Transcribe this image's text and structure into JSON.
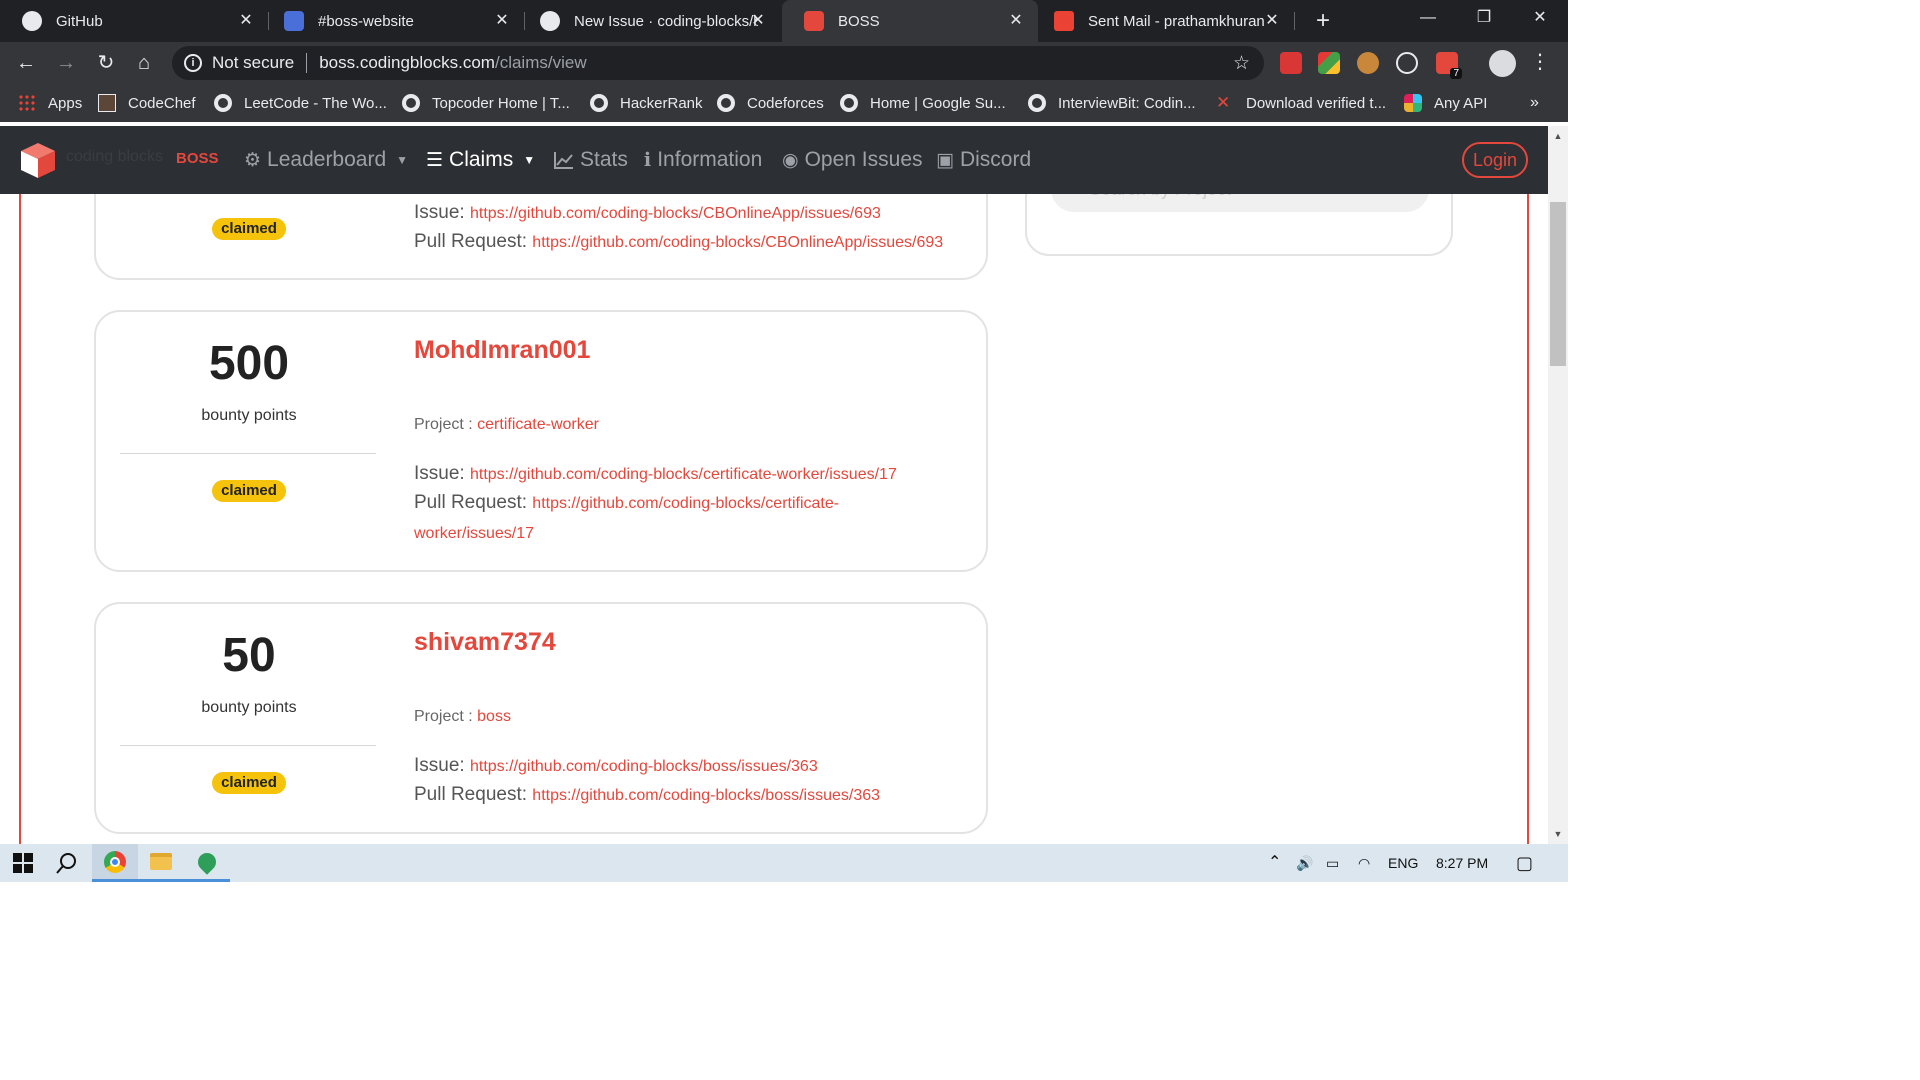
{
  "browser": {
    "tabs": [
      {
        "title": "GitHub",
        "icon": "github-icon",
        "active": false
      },
      {
        "title": "#boss-website",
        "icon": "slack-icon",
        "active": false
      },
      {
        "title": "New Issue · coding-blocks/b",
        "icon": "github-icon",
        "active": false
      },
      {
        "title": "BOSS",
        "icon": "boss-icon",
        "active": true
      },
      {
        "title": "Sent Mail - prathamkhuran",
        "icon": "gmail-icon",
        "active": false
      }
    ],
    "close_glyph": "✕",
    "new_tab_glyph": "+",
    "window_controls": {
      "minimize": "—",
      "maximize": "❐",
      "close": "✕"
    },
    "omnibox": {
      "security_label": "Not secure",
      "url_host": "boss.codingblocks.com",
      "url_path": "/claims/view"
    },
    "extension_badge": "7",
    "bookmarks": [
      {
        "label": "Apps",
        "icon": "apps-grid-icon"
      },
      {
        "label": "CodeChef",
        "icon": "codechef-icon"
      },
      {
        "label": "LeetCode - The Wo...",
        "icon": "globe-icon"
      },
      {
        "label": "Topcoder Home | T...",
        "icon": "globe-icon"
      },
      {
        "label": "HackerRank",
        "icon": "globe-icon"
      },
      {
        "label": "Codeforces",
        "icon": "globe-icon"
      },
      {
        "label": "Home | Google Su...",
        "icon": "globe-icon"
      },
      {
        "label": "InterviewBit: Codin...",
        "icon": "globe-icon"
      },
      {
        "label": "Download verified t...",
        "icon": "x-logo-icon"
      },
      {
        "label": "Any API",
        "icon": "slack-icon"
      }
    ],
    "bookmarks_more": "»"
  },
  "site": {
    "brand": {
      "text": "coding blocks",
      "sub": "BOSS"
    },
    "nav": [
      {
        "label": "Leaderboard",
        "icon": "gear-icon",
        "glyph": "⚙",
        "dropdown": true,
        "active": false
      },
      {
        "label": "Claims",
        "icon": "list-icon",
        "glyph": "☰",
        "dropdown": true,
        "active": true
      },
      {
        "label": "Stats",
        "icon": "chart-icon",
        "glyph": "📈",
        "dropdown": false,
        "active": false
      },
      {
        "label": "Information",
        "icon": "info-icon",
        "glyph": "ℹ",
        "dropdown": false,
        "active": false
      },
      {
        "label": "Open Issues",
        "icon": "github-icon",
        "glyph": "◉",
        "dropdown": false,
        "active": false
      },
      {
        "label": "Discord",
        "icon": "discord-icon",
        "glyph": "▣",
        "dropdown": false,
        "active": false
      }
    ],
    "login_label": "Login",
    "search_placeholder": "Search by Project"
  },
  "claims": {
    "points_label": "bounty points",
    "status_label": "claimed",
    "project_label": "Project :",
    "issue_label": "Issue:",
    "pr_label": "Pull Request:",
    "items": [
      {
        "user": "",
        "points": "",
        "project": "",
        "issue": "https://github.com/coding-blocks/CBOnlineApp/issues/693",
        "pr": "https://github.com/coding-blocks/CBOnlineApp/issues/693"
      },
      {
        "user": "MohdImran001",
        "points": "500",
        "project": "certificate-worker",
        "issue": "https://github.com/coding-blocks/certificate-worker/issues/17",
        "pr": "https://github.com/coding-blocks/certificate-worker/issues/17"
      },
      {
        "user": "shivam7374",
        "points": "50",
        "project": "boss",
        "issue": "https://github.com/coding-blocks/boss/issues/363",
        "pr": "https://github.com/coding-blocks/boss/issues/363"
      }
    ]
  },
  "taskbar": {
    "apps": [
      "windows-start-icon",
      "search-icon",
      "chrome-icon",
      "file-explorer-icon",
      "maps-icon"
    ],
    "language": "ENG",
    "time": "8:27 PM"
  },
  "colors": {
    "brand_red": "#e4473c",
    "badge_yellow": "#f5c30c",
    "navbar_bg": "#2c2f33",
    "chrome_dark": "#202124"
  }
}
